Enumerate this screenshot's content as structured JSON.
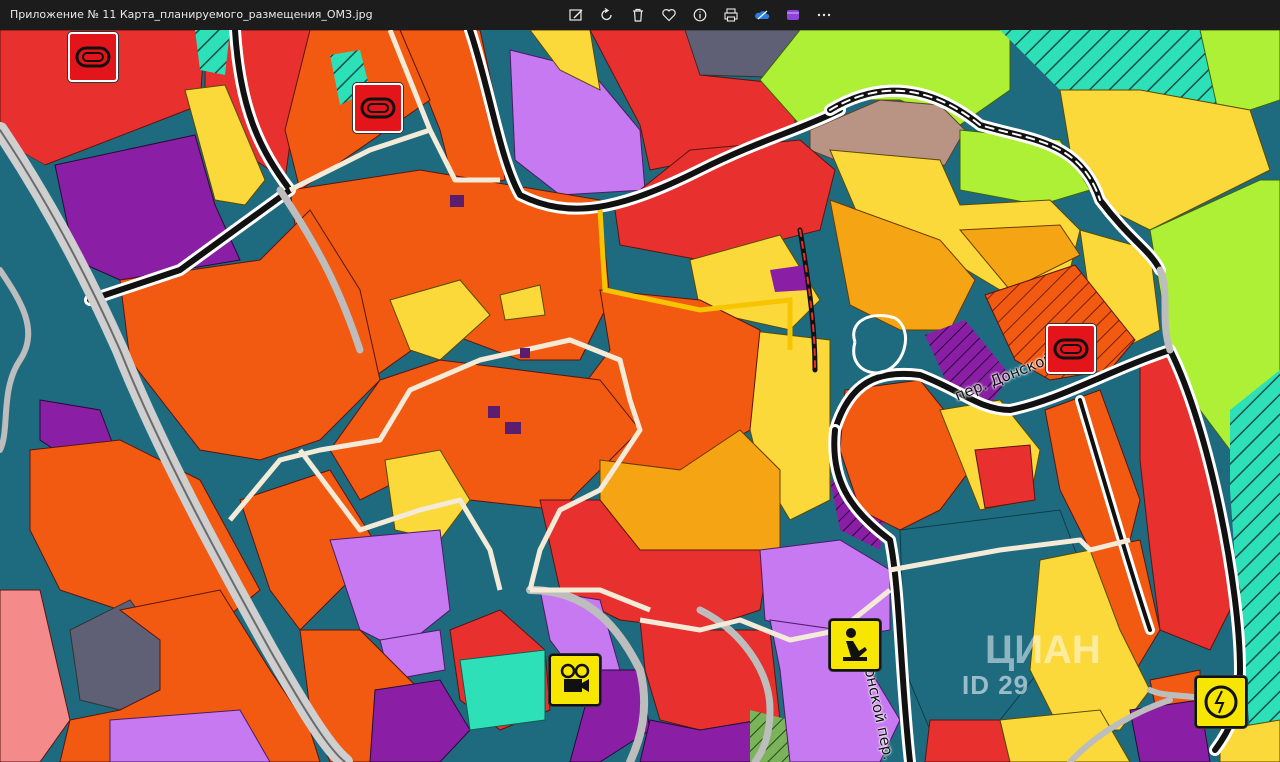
{
  "window": {
    "title": "Приложение № 11 Карта_планируемого_размещения_ОМЗ.jpg"
  },
  "toolbar": {
    "buttons": [
      {
        "name": "edit-image-button",
        "icon": "edit-image-icon"
      },
      {
        "name": "rotate-button",
        "icon": "rotate-icon"
      },
      {
        "name": "delete-button",
        "icon": "trash-icon"
      },
      {
        "name": "favorite-button",
        "icon": "heart-icon"
      },
      {
        "name": "info-button",
        "icon": "info-icon"
      },
      {
        "name": "print-button",
        "icon": "print-icon"
      },
      {
        "name": "onedrive-button",
        "icon": "onedrive-cloud-icon"
      },
      {
        "name": "clipchamp-button",
        "icon": "clipchamp-icon"
      },
      {
        "name": "more-options-button",
        "icon": "ellipsis-icon"
      }
    ]
  },
  "map": {
    "streets": {
      "donskoy_lane_1": "пер. Донской",
      "donskoy_lane_2": "Донской пер."
    },
    "watermark": {
      "brand": "ЦИАН",
      "id_text": "ID 29"
    },
    "colors": {
      "residential_orange": "#f25a12",
      "commercial_red": "#e8302e",
      "yellow_low": "#fbd93a",
      "purple": "#8a1fa6",
      "lilac": "#c679f0",
      "teal_road": "#1e6b80",
      "lime_green": "#aef035",
      "mint_hatch": "#2de0b8"
    }
  }
}
